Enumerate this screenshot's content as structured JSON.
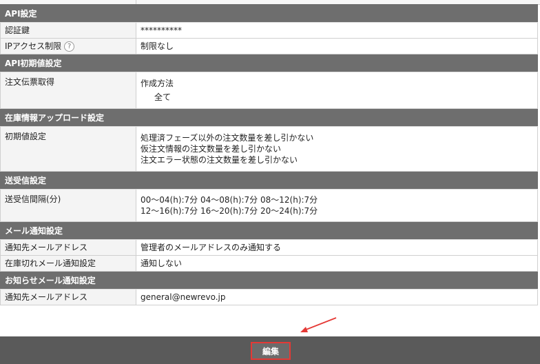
{
  "sections": [
    {
      "title": "API設定",
      "rows": [
        {
          "label": "認証鍵",
          "lines": [
            "**********"
          ]
        },
        {
          "label": "IPアクセス制限",
          "help": "?",
          "lines": [
            "制限なし"
          ]
        }
      ]
    },
    {
      "title": "API初期値設定",
      "rows": [
        {
          "label": "注文伝票取得",
          "lines": [
            "作成方法"
          ],
          "sub": "全て"
        }
      ]
    },
    {
      "title": "在庫情報アップロード設定",
      "rows": [
        {
          "label": "初期値設定",
          "lines": [
            "処理済フェーズ以外の注文数量を差し引かない",
            "仮注文情報の注文数量を差し引かない",
            "注文エラー状態の注文数量を差し引かない"
          ]
        }
      ]
    },
    {
      "title": "送受信設定",
      "rows": [
        {
          "label": "送受信間隔(分)",
          "lines": [
            "00～04(h):7分 04～08(h):7分 08～12(h):7分",
            "12～16(h):7分 16～20(h):7分 20～24(h):7分"
          ]
        }
      ]
    },
    {
      "title": "メール通知設定",
      "rows": [
        {
          "label": "通知先メールアドレス",
          "lines": [
            "管理者のメールアドレスのみ通知する"
          ]
        },
        {
          "label": "在庫切れメール通知設定",
          "lines": [
            "通知しない"
          ]
        }
      ]
    },
    {
      "title": "お知らせメール通知設定",
      "rows": [
        {
          "label": "通知先メールアドレス",
          "lines": [
            "general@newrevo.jp"
          ]
        }
      ]
    }
  ],
  "footer": {
    "edit_label": "編集"
  },
  "colors": {
    "section_header": "#6e6e6e",
    "label_bg": "#f4f4f4",
    "footer_bg": "#5a5a5a",
    "highlight": "#e53935"
  }
}
